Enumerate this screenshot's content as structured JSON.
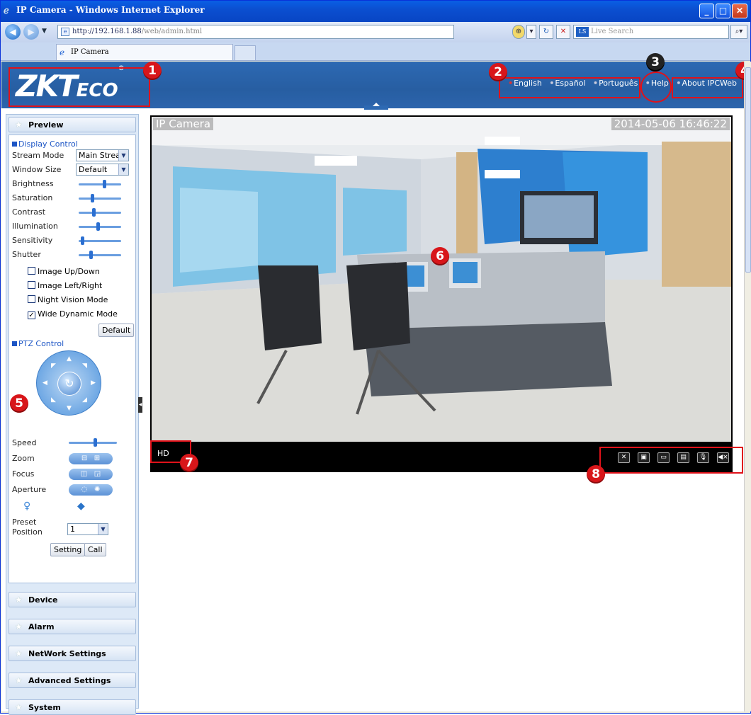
{
  "window": {
    "title": "IP Camera - Windows Internet Explorer",
    "minimize_icon": "minimize-icon",
    "maximize_icon": "maximize-icon",
    "close_icon": "close-icon"
  },
  "address": {
    "url_host": "http://192.168.1.88",
    "url_path": "/web/admin.html",
    "search_placeholder": "Live Search"
  },
  "tabs": [
    {
      "label": "IP Camera"
    }
  ],
  "header": {
    "logo_text": "ZKT",
    "logo_suffix": "ECO",
    "logo_reg": "®",
    "languages": [
      "English",
      "Español",
      "Português"
    ],
    "help": "Help",
    "about": "About IPCWeb"
  },
  "sidebar": {
    "preview": "Preview",
    "display_control": "Display Control",
    "stream_mode_label": "Stream Mode",
    "stream_mode_value": "Main Strea",
    "window_size_label": "Window Size",
    "window_size_value": "Default",
    "sliders": [
      {
        "label": "Brightness",
        "value": 0.62
      },
      {
        "label": "Saturation",
        "value": 0.3
      },
      {
        "label": "Contrast",
        "value": 0.35
      },
      {
        "label": "Illumination",
        "value": 0.45
      },
      {
        "label": "Sensitivity",
        "value": 0.05
      },
      {
        "label": "Shutter",
        "value": 0.28
      }
    ],
    "checkboxes": [
      {
        "label": "Image Up/Down",
        "checked": false
      },
      {
        "label": "Image Left/Right",
        "checked": false
      },
      {
        "label": "Night Vision Mode",
        "checked": false
      },
      {
        "label": "Wide Dynamic Mode",
        "checked": true
      }
    ],
    "default_btn": "Default",
    "ptz_control": "PTZ Control",
    "speed_label": "Speed",
    "speed_value": 0.55,
    "zoom_label": "Zoom",
    "focus_label": "Focus",
    "aperture_label": "Aperture",
    "preset_label_1": "Preset",
    "preset_label_2": "Position",
    "preset_value": "1",
    "setting_btn": "Setting",
    "call_btn": "Call",
    "sections": [
      "Device",
      "Alarm",
      "NetWork Settings",
      "Advanced Settings",
      "System"
    ]
  },
  "video": {
    "caption": "IP Camera",
    "timestamp": "2014-05-06 16:46:22",
    "quality": "HD"
  },
  "callouts": [
    "1",
    "2",
    "3",
    "4",
    "5",
    "6",
    "7",
    "8"
  ]
}
